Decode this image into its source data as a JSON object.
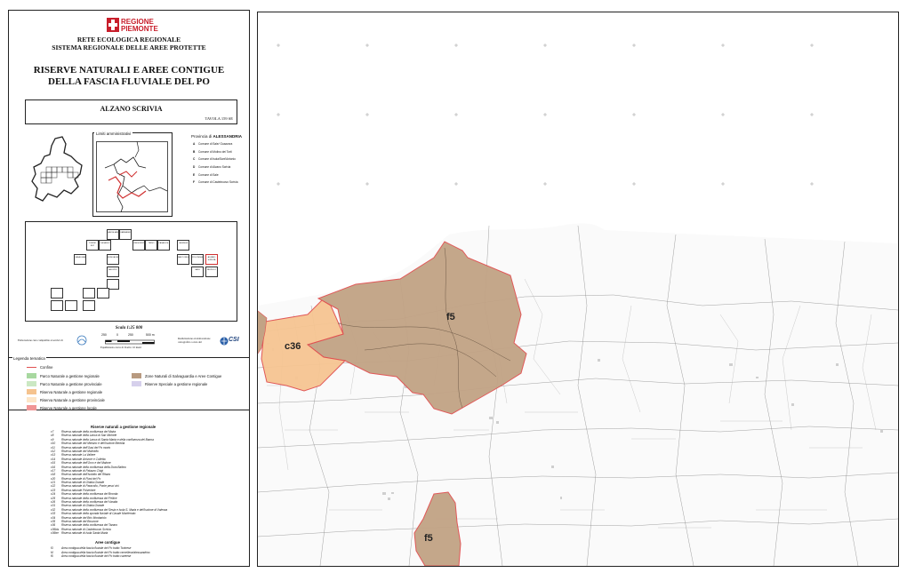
{
  "header": {
    "logo_text_1": "REGIONE",
    "logo_text_2": "PIEMONTE",
    "network_title": "RETE ECOLOGICA REGIONALE",
    "system_title": "SISTEMA REGIONALE DELLE AREE PROTETTE",
    "main_title_1": "RISERVE NATURALI E AREE CONTIGUE",
    "main_title_2": "DELLA FASCIA FLUVIALE DEL PO"
  },
  "sheet": {
    "name": "ALZANO SCRIVIA",
    "number": "TAVOLA 159 SE"
  },
  "admin": {
    "title": "Limiti amministrativi",
    "province_label": "Provincia di",
    "province_name": "ALESSANDRIA",
    "comuni": [
      {
        "letter": "A",
        "name": "Comune di Sale/ Guazzora"
      },
      {
        "letter": "B",
        "name": "Comune di Molino dei Torti"
      },
      {
        "letter": "C",
        "name": "Comune di Isola/Sant'Antonio"
      },
      {
        "letter": "D",
        "name": "Comune di Alzano Scrivia"
      },
      {
        "letter": "E",
        "name": "Comune di Sale"
      },
      {
        "letter": "F",
        "name": "Comune di Castelnuovo Scrivia"
      }
    ]
  },
  "scale": {
    "title": "Scala 1:25 000",
    "ticks": [
      "250",
      "0",
      "250",
      "500 m"
    ],
    "elaborated_by": "Elaborazione cura compatible ai servizi di",
    "equidistance": "Equidistanza curve di livello: 10 metri",
    "realized": "Realizzazione ed elaborazione cartografica a cura del",
    "csi_logo": "CSI"
  },
  "legend": {
    "title": "Legenda tematica",
    "boundary": "Confine",
    "items": [
      {
        "label": "Parco Naturale a gestione regionale",
        "color": "#a8d8a0"
      },
      {
        "label": "Parco Naturale a gestione provinciale",
        "color": "#cbe8c3"
      },
      {
        "label": "Riserva Naturale a gestione regionale",
        "color": "#f5c38e"
      },
      {
        "label": "Riserva Naturale a gestione provinciale",
        "color": "#fde6c8"
      },
      {
        "label": "Riserve Naturale a gestione locale",
        "color": "#f19696"
      }
    ],
    "items_right": [
      {
        "label": "Zone Naturali di Salvaguardia e Aree Contigue",
        "color": "#b89a80"
      },
      {
        "label": "Riserve Speciale a gestione regionale",
        "color": "#d6d0ec"
      }
    ]
  },
  "reserves": {
    "title": "Riserve naturali a gestione regionale",
    "list": [
      {
        "code": "c7",
        "name": "Riserva naturale della confluenza del Maira"
      },
      {
        "code": "c8",
        "name": "Riserva naturale della Lanca di San Michele"
      },
      {
        "code": "c9",
        "name": "Riserva naturale della Lanca di Santa Marta e della confluenza del Banna"
      },
      {
        "code": "c10",
        "name": "Riserva naturale del Meisino e dell'Isolone Bertolla"
      },
      {
        "code": "c11",
        "name": "Riserva naturale dell'Oasi del Po morto"
      },
      {
        "code": "c12",
        "name": "Riserva naturale del Molinello"
      },
      {
        "code": "c13",
        "name": "Riserva naturale La Vallere"
      },
      {
        "code": "c14",
        "name": "Riserva naturale Arrivore e Colletta"
      },
      {
        "code": "c15",
        "name": "Riserva naturale dell'Orco e del Malone"
      },
      {
        "code": "c16",
        "name": "Riserva naturale della confluenza della Dora Baltea"
      },
      {
        "code": "c17",
        "name": "Riserva naturale di Palazzo Chigi"
      },
      {
        "code": "c18",
        "name": "Riserva naturale dell'Isolotto del Ritano"
      },
      {
        "code": "c20",
        "name": "Riserva naturale di Fiani del Po"
      },
      {
        "code": "c21",
        "name": "Riserva naturale di Ghiaia Grande"
      },
      {
        "code": "c22",
        "name": "Riserva naturale di Paracollo, Ponte pesci vivi"
      },
      {
        "code": "c23",
        "name": "Riserva naturale Polveriere"
      },
      {
        "code": "c24",
        "name": "Riserva naturale della confluenza del Bronda"
      },
      {
        "code": "c25",
        "name": "Riserva naturale della confluenza del Pellice"
      },
      {
        "code": "c26",
        "name": "Riserva naturale della confluenza del Varaita"
      },
      {
        "code": "c31",
        "name": "Riserva naturale di Ghiaia Grande"
      },
      {
        "code": "c32",
        "name": "Riserva naturale della confluenza del Sesia e Isola S. Maria e dell'Isolone di Valenza"
      },
      {
        "code": "c33",
        "name": "Riserva naturale della sponda fluviale di Casale Monferrato"
      },
      {
        "code": "c34",
        "name": "Riserva naturale del Bric Montariolo"
      },
      {
        "code": "c35",
        "name": "Riserva naturale del Boscone"
      },
      {
        "code": "c36",
        "name": "Riserva naturale della confluenza del Tanaro"
      },
      {
        "code": "c36bis",
        "name": "Riserva naturale di Castelnuovo Scrivia"
      },
      {
        "code": "c36ter",
        "name": "Riserva naturale di Isola Santa Maria"
      }
    ],
    "contig_title": "Aree contigue",
    "contig_list": [
      {
        "code": "f3",
        "name": "Area contigua della fascia fluviale del Po tratto Torinese"
      },
      {
        "code": "f4",
        "name": "Area contigua della fascia fluviale del Po tratto vercellese/alessandrino"
      },
      {
        "code": "f5",
        "name": "Area contigua della fascia fluviale del Po tratto cuneese"
      }
    ]
  },
  "map": {
    "labels": {
      "f5_upper": "f5",
      "c36": "c36",
      "f5_lower": "f5"
    },
    "colors": {
      "contigua": "#c2a385",
      "riserva": "#f6c592",
      "border": "#e05050"
    }
  },
  "index_tiles": [
    {
      "id": "t1",
      "text": "SAVIGLIANO"
    },
    {
      "id": "t2",
      "text": "CARMAGNOLA"
    },
    {
      "id": "t3",
      "text": "TORINO EST"
    },
    {
      "id": "t4",
      "text": "CHIVASSO"
    },
    {
      "id": "t5",
      "text": "CRESCENTINO"
    },
    {
      "id": "t6",
      "text": "TRINO"
    },
    {
      "id": "t7",
      "text": "CASALE M."
    },
    {
      "id": "t8",
      "text": "VALENZA"
    },
    {
      "id": "t9",
      "text": "ALZANO SCRIVIA"
    },
    {
      "id": "t10",
      "text": "SALE"
    },
    {
      "id": "t11",
      "text": "CASALGRASSO"
    },
    {
      "id": "t12",
      "text": "MONCALIERI"
    },
    {
      "id": "t13",
      "text": "RACCONIGI"
    },
    {
      "id": "t14",
      "text": "POLONGHERA"
    },
    {
      "id": "t15",
      "text": "REVELLO"
    },
    {
      "id": "t16",
      "text": "SALUZZO"
    }
  ]
}
